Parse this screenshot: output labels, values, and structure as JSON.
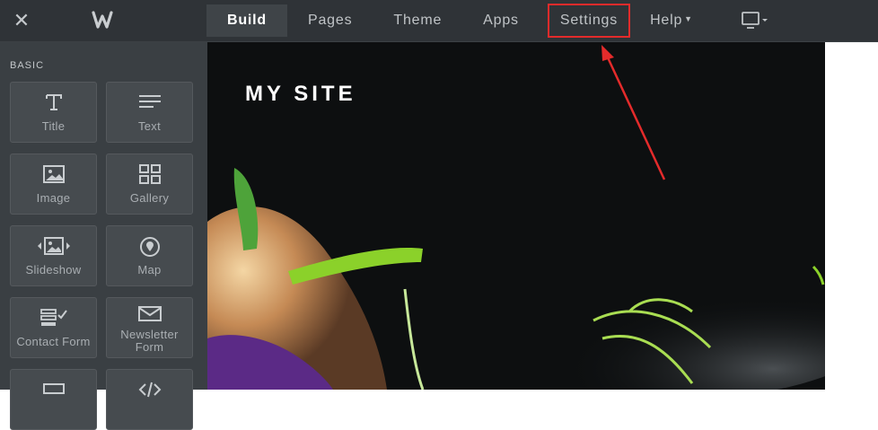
{
  "topbar": {
    "nav": [
      {
        "label": "Build"
      },
      {
        "label": "Pages"
      },
      {
        "label": "Theme"
      },
      {
        "label": "Apps"
      },
      {
        "label": "Settings"
      },
      {
        "label": "Help"
      }
    ],
    "active_tab": "Build",
    "highlighted_tab": "Settings"
  },
  "sidebar": {
    "section_label": "BASIC",
    "tiles": [
      {
        "label": "Title",
        "icon": "title-icon"
      },
      {
        "label": "Text",
        "icon": "text-lines-icon"
      },
      {
        "label": "Image",
        "icon": "image-icon"
      },
      {
        "label": "Gallery",
        "icon": "gallery-grid-icon"
      },
      {
        "label": "Slideshow",
        "icon": "slideshow-icon"
      },
      {
        "label": "Map",
        "icon": "map-pin-icon"
      },
      {
        "label": "Contact Form",
        "icon": "contact-form-icon"
      },
      {
        "label": "Newsletter Form",
        "icon": "envelope-icon"
      }
    ]
  },
  "canvas": {
    "site_title": "MY SITE"
  },
  "colors": {
    "topbar_bg": "#2f3337",
    "sidebar_bg": "#3a3f43",
    "tile_bg": "#464b4f",
    "highlight": "#e42b2b"
  }
}
